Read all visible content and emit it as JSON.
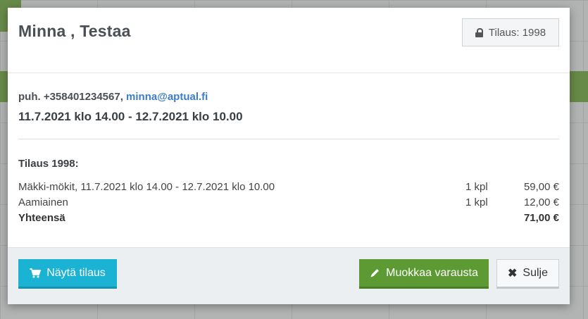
{
  "modal": {
    "title": "Minna , Testaa",
    "order_badge": "Tilaus: 1998",
    "contact": {
      "phone_prefix": "puh. +358401234567, ",
      "email": "minna@aptual.fi"
    },
    "dates": "11.7.2021 klo 14.00 - 12.7.2021 klo 10.00",
    "order_title": "Tilaus 1998:",
    "lines": [
      {
        "desc": "Mäkki-mökit, 11.7.2021 klo 14.00 - 12.7.2021 klo 10.00",
        "qty": "1 kpl",
        "price": "59,00 €"
      },
      {
        "desc": "Aamiainen",
        "qty": "1 kpl",
        "price": "12,00 €"
      }
    ],
    "total": {
      "label": "Yhteensä",
      "price": "71,00 €"
    },
    "buttons": {
      "show_order": "Näytä tilaus",
      "edit_booking": "Muokkaa varausta",
      "close": "Sulje"
    }
  },
  "colors": {
    "show_button": "#1ab3d3",
    "edit_button": "#5d9a33",
    "email_link": "#3d7cc9"
  },
  "icons": {
    "order_badge": "lock-icon",
    "show_order": "shopping-cart-icon",
    "edit_booking": "pencil-icon",
    "close": "close-icon"
  }
}
